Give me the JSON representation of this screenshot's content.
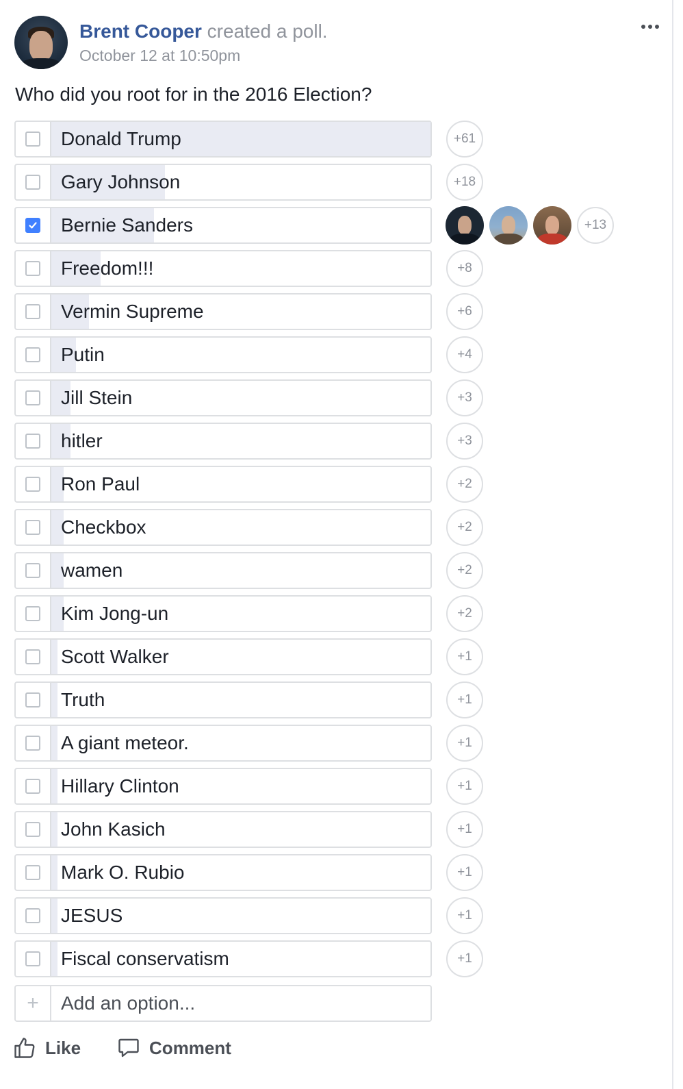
{
  "post": {
    "author": "Brent Cooper",
    "action": " created a poll.",
    "timestamp": "October 12 at 10:50pm",
    "question": "Who did you root for in the 2016 Election?"
  },
  "poll": {
    "options": [
      {
        "label": "Donald Trump",
        "votes": "+61",
        "checked": false,
        "fill": 1.0
      },
      {
        "label": "Gary Johnson",
        "votes": "+18",
        "checked": false,
        "fill": 0.3
      },
      {
        "label": "Bernie Sanders",
        "votes": "+13",
        "checked": true,
        "fill": 0.27
      },
      {
        "label": "Freedom!!!",
        "votes": "+8",
        "checked": false,
        "fill": 0.13
      },
      {
        "label": "Vermin Supreme",
        "votes": "+6",
        "checked": false,
        "fill": 0.1
      },
      {
        "label": "Putin",
        "votes": "+4",
        "checked": false,
        "fill": 0.065
      },
      {
        "label": "Jill Stein",
        "votes": "+3",
        "checked": false,
        "fill": 0.05
      },
      {
        "label": "hitler",
        "votes": "+3",
        "checked": false,
        "fill": 0.05
      },
      {
        "label": "Ron Paul",
        "votes": "+2",
        "checked": false,
        "fill": 0.033
      },
      {
        "label": "Checkbox",
        "votes": "+2",
        "checked": false,
        "fill": 0.033
      },
      {
        "label": "wamen",
        "votes": "+2",
        "checked": false,
        "fill": 0.033
      },
      {
        "label": "Kim Jong-un",
        "votes": "+2",
        "checked": false,
        "fill": 0.033
      },
      {
        "label": "Scott Walker",
        "votes": "+1",
        "checked": false,
        "fill": 0.017
      },
      {
        "label": "Truth",
        "votes": "+1",
        "checked": false,
        "fill": 0.017
      },
      {
        "label": "A giant meteor.",
        "votes": "+1",
        "checked": false,
        "fill": 0.017
      },
      {
        "label": "Hillary Clinton",
        "votes": "+1",
        "checked": false,
        "fill": 0.017
      },
      {
        "label": "John Kasich",
        "votes": "+1",
        "checked": false,
        "fill": 0.017
      },
      {
        "label": "Mark O. Rubio",
        "votes": "+1",
        "checked": false,
        "fill": 0.017
      },
      {
        "label": "JESUS",
        "votes": "+1",
        "checked": false,
        "fill": 0.017
      },
      {
        "label": "Fiscal conservatism",
        "votes": "+1",
        "checked": false,
        "fill": 0.017
      }
    ],
    "add_placeholder": "Add an option...",
    "add_icon": "plus-icon"
  },
  "actions": {
    "like_label": "Like",
    "comment_label": "Comment"
  },
  "colors": {
    "author_link": "#365899",
    "meta_text": "#90949c",
    "checkbox_checked": "#4080ff",
    "bar_fill": "#e9ebf3",
    "border": "#dddfe2"
  }
}
